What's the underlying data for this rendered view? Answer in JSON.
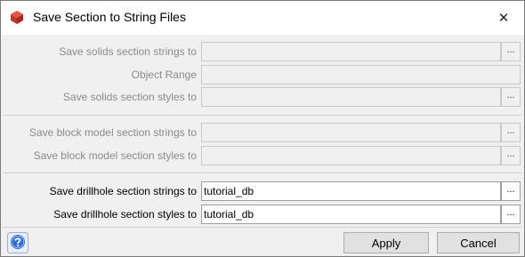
{
  "window": {
    "title": "Save Section to String Files",
    "close_glyph": "✕"
  },
  "rows": [
    {
      "label": "Save solids section strings to",
      "value": "",
      "enabled": false,
      "browse": "..."
    },
    {
      "label": "Object Range",
      "value": "",
      "enabled": false
    },
    {
      "label": "Save solids section styles to",
      "value": "",
      "enabled": false,
      "browse": "..."
    },
    {
      "label": "Save block model section strings to",
      "value": "",
      "enabled": false,
      "browse": "..."
    },
    {
      "label": "Save block model section styles to",
      "value": "",
      "enabled": false,
      "browse": "..."
    },
    {
      "label": "Save drillhole section strings to",
      "value": "tutorial_db",
      "enabled": true,
      "browse": "..."
    },
    {
      "label": "Save drillhole section styles to",
      "value": "tutorial_db",
      "enabled": true,
      "browse": "..."
    }
  ],
  "footer": {
    "help_icon": "question-mark-icon",
    "apply_label": "Apply",
    "cancel_label": "Cancel"
  },
  "colors": {
    "accent": "#1e63c8",
    "disabled_text": "#8a8a8a"
  }
}
